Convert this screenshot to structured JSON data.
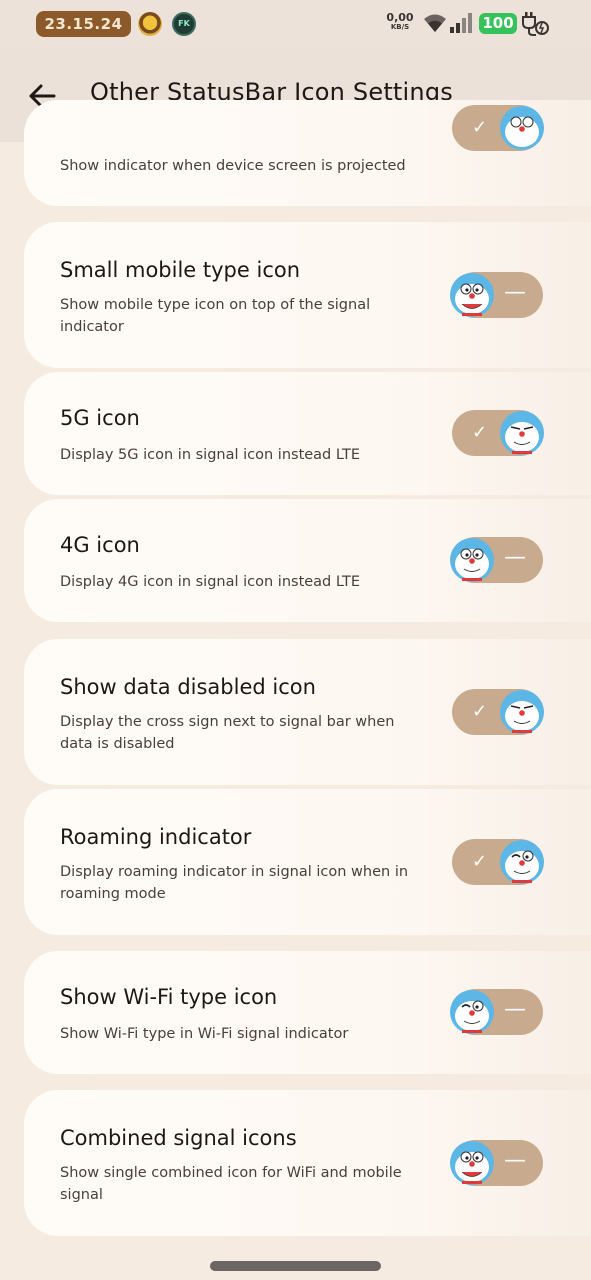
{
  "status_bar": {
    "time": "23.15.24",
    "net_speed_value": "0,00",
    "net_speed_unit": "KB/S",
    "battery": "100",
    "notif_badge": "FK"
  },
  "app_bar": {
    "title": "Other StatusBar Icon Settings"
  },
  "settings": [
    {
      "title": "",
      "description": "Show indicator when device screen is projected",
      "enabled": true
    },
    {
      "title": "Small mobile type icon",
      "description": "Show mobile type icon on top of the signal indicator",
      "enabled": false
    },
    {
      "title": "5G icon",
      "description": "Display 5G icon in signal icon instead LTE",
      "enabled": true
    },
    {
      "title": "4G icon",
      "description": "Display 4G icon in signal icon instead LTE",
      "enabled": false
    },
    {
      "title": "Show data disabled icon",
      "description": "Display the cross sign next to signal bar when data is disabled",
      "enabled": true
    },
    {
      "title": "Roaming indicator",
      "description": "Display roaming indicator in signal icon when in roaming mode",
      "enabled": true
    },
    {
      "title": "Show Wi-Fi type icon",
      "description": "Show Wi-Fi type in Wi-Fi signal indicator",
      "enabled": false
    },
    {
      "title": "Combined signal icons",
      "description": "Show single combined icon for WiFi and mobile signal",
      "enabled": false
    }
  ],
  "toggle_marks": {
    "on": "✓",
    "off": "—"
  },
  "colors": {
    "background": "#f6ebe1",
    "toggle_track": "#c8ab8f",
    "battery": "#36c25a",
    "time_pill": "#8c5a2a"
  }
}
